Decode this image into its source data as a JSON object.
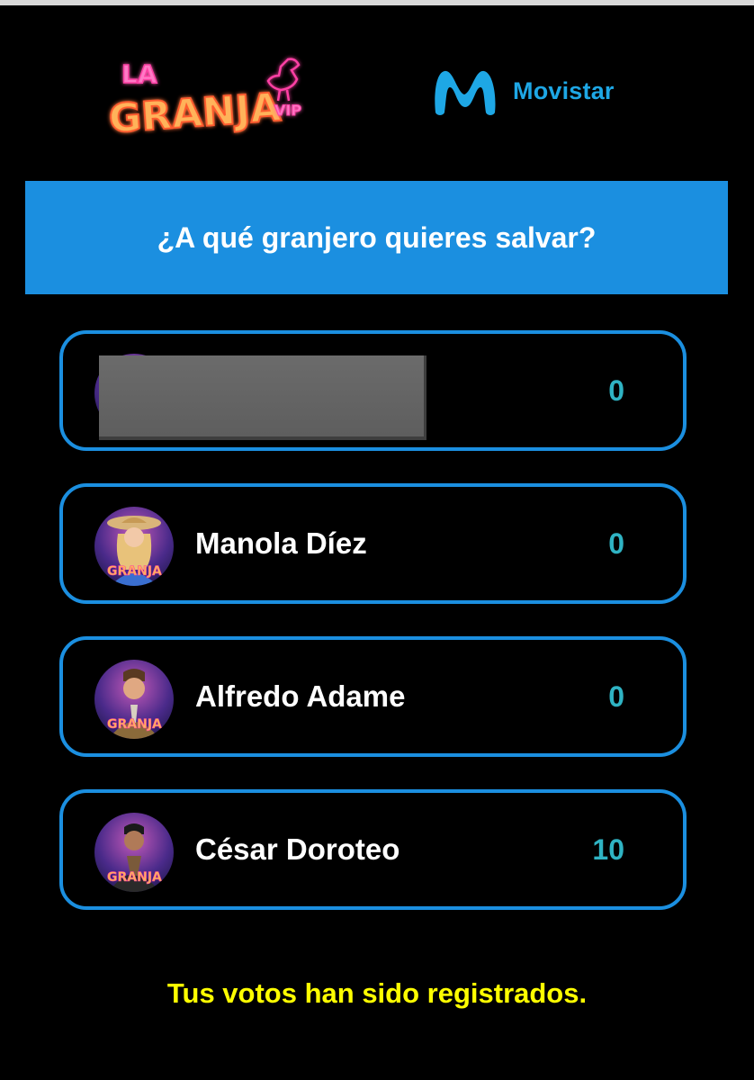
{
  "header": {
    "show_logo": {
      "line1": "LA",
      "line2": "GRANJA",
      "badge": "VIP"
    },
    "sponsor": {
      "name": "Movistar",
      "mark_icon": "movistar-m-icon"
    }
  },
  "poll": {
    "question": "¿A qué granjero quieres salvar?",
    "options": [
      {
        "name": "",
        "votes": "0",
        "avatar_icon": "contestant-avatar",
        "redacted": true
      },
      {
        "name": "Manola Díez",
        "votes": "0",
        "avatar_icon": "contestant-avatar"
      },
      {
        "name": "Alfredo Adame",
        "votes": "0",
        "avatar_icon": "contestant-avatar"
      },
      {
        "name": "César Doroteo",
        "votes": "10",
        "avatar_icon": "contestant-avatar"
      }
    ],
    "confirmation": "Tus votos han sido registrados."
  },
  "colors": {
    "background": "#000000",
    "accent_blue": "#1b8fe0",
    "vote_count": "#2fb3c3",
    "confirmation": "#ffff00",
    "logo_neon_pink": "#ff3fa4",
    "logo_neon_orange": "#ff7a2e"
  }
}
